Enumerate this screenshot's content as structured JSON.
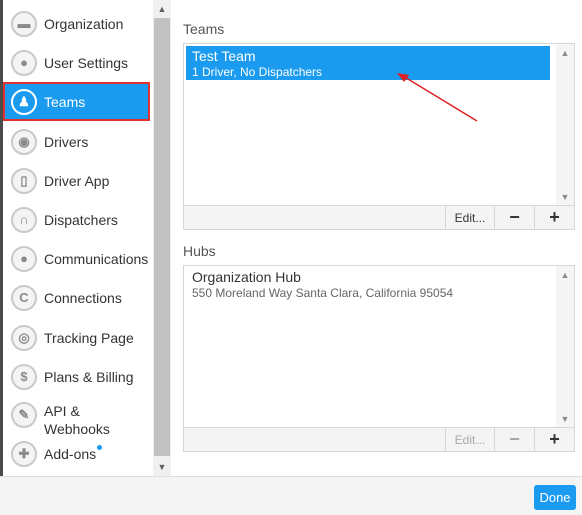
{
  "sidebar": {
    "items": [
      {
        "label": "Organization",
        "icon": "briefcase-icon",
        "glyph": "▬"
      },
      {
        "label": "User Settings",
        "icon": "user-icon",
        "glyph": "●"
      },
      {
        "label": "Teams",
        "icon": "team-icon",
        "glyph": "♟",
        "active": true
      },
      {
        "label": "Drivers",
        "icon": "steering-wheel-icon",
        "glyph": "◉"
      },
      {
        "label": "Driver App",
        "icon": "phone-icon",
        "glyph": "▯"
      },
      {
        "label": "Dispatchers",
        "icon": "headset-icon",
        "glyph": "∩"
      },
      {
        "label": "Communications",
        "icon": "chat-bubble-icon",
        "glyph": "●"
      },
      {
        "label": "Connections",
        "icon": "connection-icon",
        "glyph": "C"
      },
      {
        "label": "Tracking Page",
        "icon": "target-icon",
        "glyph": "◎"
      },
      {
        "label": "Plans & Billing",
        "icon": "dollar-icon",
        "glyph": "$"
      },
      {
        "label": "API & Webhooks",
        "icon": "wrench-icon",
        "glyph": "✎"
      },
      {
        "label": "Add-ons",
        "icon": "puzzle-icon",
        "glyph": "✚"
      }
    ]
  },
  "teams": {
    "label": "Teams",
    "items": [
      {
        "name": "Test Team",
        "detail": "1 Driver, No Dispatchers"
      }
    ],
    "edit_label": "Edit...",
    "remove_label": "−",
    "add_label": "+"
  },
  "hubs": {
    "label": "Hubs",
    "items": [
      {
        "name": "Organization Hub",
        "address": "550 Moreland Way Santa Clara, California 95054"
      }
    ],
    "edit_label": "Edit...",
    "remove_label": "−",
    "add_label": "+"
  },
  "done_label": "Done",
  "colors": {
    "accent": "#1a9bf0",
    "highlight_border": "#e03030",
    "annotation_arrow": "#e02020"
  }
}
